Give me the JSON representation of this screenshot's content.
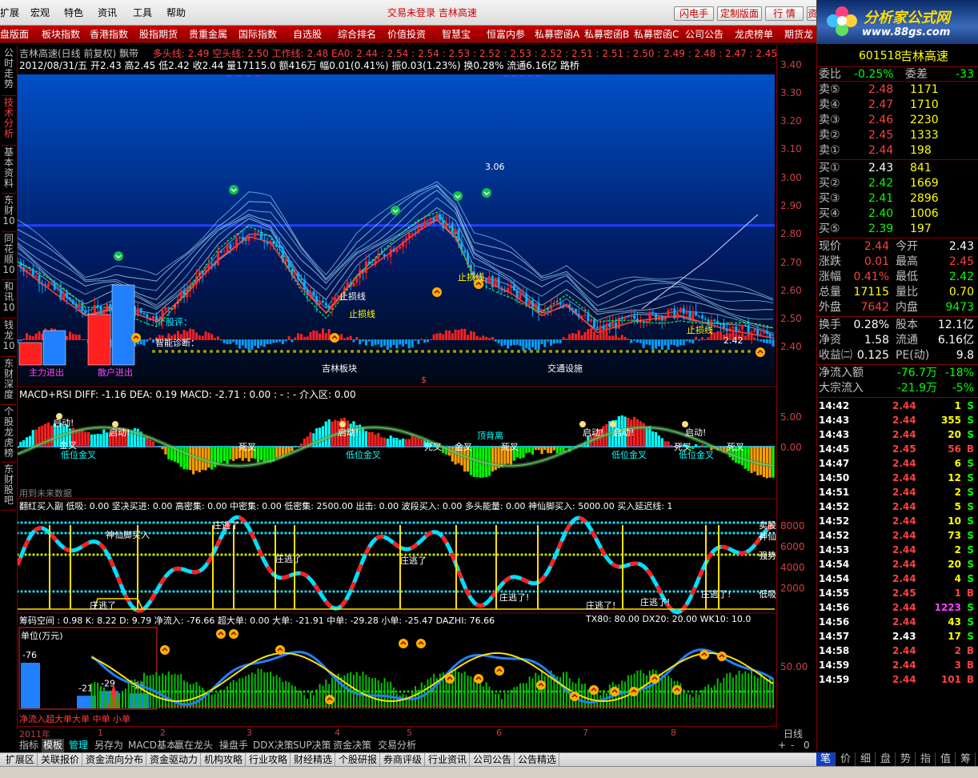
{
  "menu": [
    "扩展",
    "宏观",
    "特色",
    "资讯",
    "工具",
    "帮助"
  ],
  "app_title": "交易未登录  吉林高速",
  "top_buttons": [
    "闪电手",
    "定制版面",
    "行  情",
    "资"
  ],
  "logo": {
    "text": "分析家公式网",
    "url_text": "www.88gs.com"
  },
  "redbar": [
    "盘版面",
    "板块指数",
    "香港指数",
    "股指期货",
    "贵重金属",
    "国际指数",
    "自选股",
    "综合排名",
    "价值投资",
    "智慧宝",
    "恒富内参",
    "私募密函A",
    "私募密函B",
    "私募密函C",
    "公司公告",
    "龙虎榜单",
    "期货龙"
  ],
  "left_tabs": [
    "公时走势",
    "技术分析",
    "基本资料",
    "东财10",
    "同花顺10",
    "和讯10",
    "钱龙10",
    "东财深度",
    "个股龙虎榜",
    "东财股吧"
  ],
  "main_panel": {
    "line1_name": "吉林高速(日线 前复权) 飘带",
    "line1_values": "多头线: 2.49  空头线: 2.50    工作线: 2.48   EA0: 2.44 : 2.54 : 2.54 : 2.53 : 2.52 : 2.53 : 2.52 : 2.51 : 2.51 : 2.50 : 2.49 : 2.48 : 2.47 : 2.45",
    "line2": "2012/08/31/五 开2.43 高2.45 低2.42 收2.44 量17115.0 额416万 幅0.01(0.41%) 振0.03(1.23%) 换0.28% 流通6.16亿 路桥",
    "label_high": "3.06",
    "label_low": "2.42",
    "labels": [
      "主力进出",
      "散户进出",
      "个股评：",
      "智能诊断：",
      "吉林板块",
      "交通设施",
      "止损线",
      "止损线",
      "止损线",
      "止损线"
    ],
    "dollar": "$"
  },
  "macd_panel": {
    "title": "MACD+RSI  DIFF: -1.16  DEA: 0.19   MACD: -2.71        : 0.00  : -          :   -     介入区: 0.00",
    "labels": [
      "启动!",
      "启动!",
      "启动!",
      "启动!",
      "启动!",
      "启动!",
      "金叉",
      "低位金叉",
      "死叉",
      "低位金叉",
      "死叉",
      "金叉",
      "顶背离",
      "死叉",
      "低位金叉",
      "死叉",
      "低位金叉",
      "死叉"
    ],
    "footer": "用到未来数据",
    "axis": [
      "5.00",
      "0.00"
    ]
  },
  "third_panel": {
    "title": "翻红买入副   低吸: 0.00     坚决买进: 0.00    高密集: 0.00  中密集: 0.00  低密集: 2500.00  出击: 0.00     波段买入: 0.00         多头能量: 0.00  神仙脚买入: 5000.00    买入延迟线: 1",
    "labels": [
      "神仙脚买入",
      "庄逃了",
      "庄逃了",
      "庄逃了",
      "庄逃了",
      "庄逃了!",
      "庄逃了!",
      "庄逃了!",
      "庄逃了!"
    ],
    "right_labels": [
      "卖股",
      "神仙",
      "强势",
      "低吸"
    ],
    "axis": [
      "8000",
      "6000",
      "4000",
      "2000"
    ]
  },
  "fourth_panel": {
    "title": "筹码空间 : 0.98  K: 8.22  D: 9.79      净流入: -76.66  超大单: 0.00  大单: -21.91  中单: -29.28   小单: -25.47  DAZHI: 76.66",
    "title_right": "TX80: 80.00  DX20: 20.00  WK10: 10.0",
    "unit": "单位(万元)",
    "bars": [
      -76,
      -21,
      -29,
      -25
    ],
    "footer": "净流入超大单大单  中单  小单",
    "axis": [
      "50.00"
    ]
  },
  "price_axis": [
    "3.40",
    "3.30",
    "3.20",
    "3.10",
    "3.00",
    "2.90",
    "2.80",
    "2.70",
    "2.60",
    "2.50",
    "2.40"
  ],
  "date_axis": [
    "2011年",
    "1",
    "2",
    "3",
    "4",
    "5",
    "6",
    "7",
    "8"
  ],
  "period_label": "日线",
  "bottom_tabs": [
    "指标",
    "模板",
    "管理",
    "另存为",
    "MACD基本",
    "赢在龙头",
    "操盘手",
    "DDX决策",
    "SUP决策",
    "资金决策",
    "交易分析"
  ],
  "bottom_tabs_right": [
    "+",
    "-",
    "0"
  ],
  "bottom_tabs2": [
    "扩展区",
    "关联报价",
    "资金流向分布",
    "资金驱动力",
    "机构攻略",
    "行业攻略",
    "财经精选",
    "个股研报",
    "券商评级",
    "行业资讯",
    "公司公告",
    "公告精选"
  ],
  "right_tabs": [
    "笔",
    "价",
    "细",
    "盘",
    "势",
    "指",
    "值",
    "筹"
  ],
  "quote": {
    "code": "601518",
    "name": "吉林高速",
    "weibi_label": "委比",
    "weibi": "-0.25%",
    "weicha_label": "委差",
    "weicha": "-33",
    "sells": [
      {
        "label": "卖⑤",
        "price": "2.48",
        "vol": "1171"
      },
      {
        "label": "卖④",
        "price": "2.47",
        "vol": "1710"
      },
      {
        "label": "卖③",
        "price": "2.46",
        "vol": "2230"
      },
      {
        "label": "卖②",
        "price": "2.45",
        "vol": "1333"
      },
      {
        "label": "卖①",
        "price": "2.44",
        "vol": "198"
      }
    ],
    "buys": [
      {
        "label": "买①",
        "price": "2.43",
        "vol": "841"
      },
      {
        "label": "买②",
        "price": "2.42",
        "vol": "1669"
      },
      {
        "label": "买③",
        "price": "2.41",
        "vol": "2896"
      },
      {
        "label": "买④",
        "price": "2.40",
        "vol": "1006"
      },
      {
        "label": "买⑤",
        "price": "2.39",
        "vol": "197"
      }
    ],
    "stats": [
      {
        "l1": "现价",
        "v1": "2.44",
        "l2": "今开",
        "v2": "2.43",
        "c1": "#ff4040",
        "c2": "#ffffff"
      },
      {
        "l1": "涨跌",
        "v1": "0.01",
        "l2": "最高",
        "v2": "2.45",
        "c1": "#ff4040",
        "c2": "#ff4040"
      },
      {
        "l1": "涨幅",
        "v1": "0.41%",
        "l2": "最低",
        "v2": "2.42",
        "c1": "#ff4040",
        "c2": "#00ff00"
      },
      {
        "l1": "总量",
        "v1": "17115",
        "l2": "量比",
        "v2": "0.70",
        "c1": "#ffff00",
        "c2": "#ffff00"
      },
      {
        "l1": "外盘",
        "v1": "7642",
        "l2": "内盘",
        "v2": "9473",
        "c1": "#ff4040",
        "c2": "#00ff00"
      }
    ],
    "stats2": [
      {
        "l1": "换手",
        "v1": "0.28%",
        "l2": "股本",
        "v2": "12.1亿"
      },
      {
        "l1": "净资",
        "v1": "1.58",
        "l2": "流通",
        "v2": "6.16亿"
      },
      {
        "l1": "收益㈡",
        "v1": "0.125",
        "l2": "PE(动)",
        "v2": "9.8"
      }
    ],
    "flow": [
      {
        "l": "净流入额",
        "v": "-76.7万",
        "p": "-18%"
      },
      {
        "l": "大宗流入",
        "v": "-21.9万",
        "p": "-5%"
      }
    ],
    "ticks": [
      {
        "t": "14:42",
        "p": "2.44",
        "v": "1",
        "s": "S"
      },
      {
        "t": "14:43",
        "p": "2.44",
        "v": "355",
        "s": "S"
      },
      {
        "t": "14:43",
        "p": "2.44",
        "v": "20",
        "s": "S"
      },
      {
        "t": "14:45",
        "p": "2.45",
        "v": "56",
        "s": "B"
      },
      {
        "t": "14:47",
        "p": "2.44",
        "v": "6",
        "s": "S"
      },
      {
        "t": "14:50",
        "p": "2.44",
        "v": "12",
        "s": "S"
      },
      {
        "t": "14:51",
        "p": "2.44",
        "v": "2",
        "s": "S"
      },
      {
        "t": "14:52",
        "p": "2.44",
        "v": "5",
        "s": "S"
      },
      {
        "t": "14:52",
        "p": "2.44",
        "v": "10",
        "s": "S"
      },
      {
        "t": "14:52",
        "p": "2.44",
        "v": "73",
        "s": "S"
      },
      {
        "t": "14:53",
        "p": "2.44",
        "v": "2",
        "s": "S"
      },
      {
        "t": "14:54",
        "p": "2.44",
        "v": "20",
        "s": "S"
      },
      {
        "t": "14:54",
        "p": "2.44",
        "v": "4",
        "s": "S"
      },
      {
        "t": "14:55",
        "p": "2.45",
        "v": "1",
        "s": "B"
      },
      {
        "t": "14:56",
        "p": "2.44",
        "v": "1223",
        "s": "S"
      },
      {
        "t": "14:56",
        "p": "2.44",
        "v": "43",
        "s": "S"
      },
      {
        "t": "14:57",
        "p": "2.43",
        "v": "17",
        "s": "S"
      },
      {
        "t": "14:58",
        "p": "2.44",
        "v": "2",
        "s": "B"
      },
      {
        "t": "14:59",
        "p": "2.44",
        "v": "3",
        "s": "B"
      },
      {
        "t": "14:59",
        "p": "2.44",
        "v": "101",
        "s": "B"
      }
    ]
  }
}
